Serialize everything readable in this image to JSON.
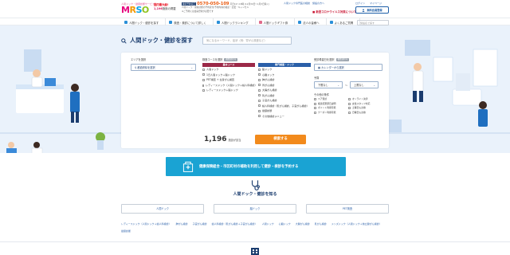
{
  "header": {
    "logo_tagline": "人間ドック・健康診断サービス",
    "logo_text": [
      "M",
      "R",
      "S",
      "O"
    ],
    "promo_line1": "国内最大級!",
    "promo_count": "1,196",
    "promo_suffix": "施設の掲載",
    "phone_label": "健診予約窓口",
    "phone_number": "0570-050-109",
    "phone_hours": "平日10〜18時 (12月30日〜1月3日除く)",
    "phone_note1": "人間ドック・健康診断の予約受付/予約内容の確認・変更・キャンセル",
    "phone_note2": "※ご予約には会員登録が必要です",
    "links": [
      "人間ドック専門医の相談",
      "施設の方へ"
    ],
    "red_notice": "■ 新型コロナウイルス対策について",
    "login": "ログイン",
    "mypage": "マイページ",
    "free_register": "無料会員登録"
  },
  "nav": {
    "items": [
      {
        "label": "人間ドック・健診を探す",
        "icon": "search-icon",
        "color": "#2a8fd8"
      },
      {
        "label": "検査・検診について詳しく",
        "icon": "stethoscope-icon",
        "color": "#2a8fd8"
      },
      {
        "label": "人間ドックランキング",
        "icon": "ranking-icon",
        "color": "#2a8fd8"
      },
      {
        "label": "人間ドックギフト券",
        "icon": "gift-icon",
        "color": "#e06a8a"
      },
      {
        "label": "法人の皆様へ",
        "icon": "building-icon",
        "color": "#2a8fd8"
      },
      {
        "label": "よくあるご質問",
        "icon": "question-icon",
        "color": "#2a8fd8"
      }
    ],
    "search_placeholder": "施設名で探す"
  },
  "hero": {
    "title": "人間ドック・健診を探す",
    "keyword_placeholder": "気になるキーワード、症状（例：胃がん検査など）",
    "area_label": "エリアを選択",
    "area_value": "都道府県を選択",
    "course_label": "検査コースを選択",
    "course_badge": "複数選択可",
    "basic_head": "基本コース",
    "basic_options": [
      "人間ドック",
      "1日人間ドック＋脳ドック",
      "PET検査 + 全身がん検査",
      "レディースドック（人間ドック＋婦人科検診）",
      "レディースドック＋脳ドック"
    ],
    "special_head": "専門検査・ドック",
    "special_options": [
      "脳ドック",
      "心臓ドック",
      "肺がん検診",
      "胃がん検診",
      "大腸がん検診",
      "乳がん検診",
      "子宮がん検診",
      "婦人科検診（乳がん検診、子宮がん検診）",
      "健康診断",
      "その他検診メニュー"
    ],
    "date_label": "受診希望日を選択",
    "date_badge": "複数選択可",
    "date_value": "カレンダーから選択",
    "budget_label": "予算",
    "budget_min": "下限なし",
    "budget_sep": "〜",
    "budget_max": "上限なし",
    "other_label": "その他の条件",
    "other_options": [
      "ペア受診",
      "オンライン決済",
      "検査結果即日説明",
      "女性スタッフ対応",
      "ポイント利用可能",
      "土曜日も診療",
      "クーポン利用可能",
      "日曜日も診療"
    ],
    "count_value": "1,196",
    "count_unit": "施設が該当",
    "search_button": "検索する"
  },
  "banner": {
    "text": "健康保険組合・市区町村の補助を利用して健診・検診を予約する",
    "bg_color": "#1aa3d3"
  },
  "section": {
    "title": "人間ドック・健診を知る",
    "tiles": [
      "人間ドック",
      "脳ドック",
      "PET検査"
    ],
    "links": [
      "レディースドック（人間ドック＋婦人科検診）",
      "肺がん検診",
      "子宮がん検診",
      "婦人科検診（乳がん検診＋子宮がん検診）",
      "人間ドック",
      "心臓ドック",
      "大腸がん検診",
      "乳がん検診",
      "メンズドック（人間ドック＋前立腺がん検診）",
      "健康診断"
    ]
  },
  "colors": {
    "navy": "#1a3c6e",
    "orange": "#f28a1c",
    "link": "#2a5fa8",
    "hero_bg": "#eaf2fb",
    "basic_head": "#9b2948",
    "special_head": "#2a5fa8"
  }
}
